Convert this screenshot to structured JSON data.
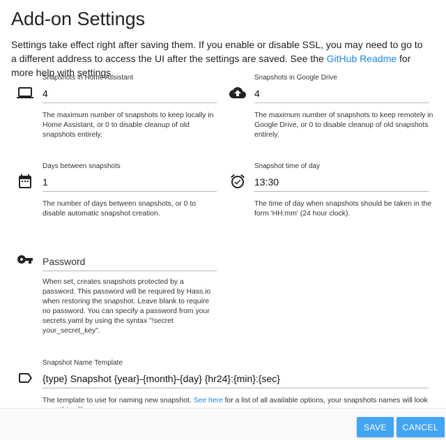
{
  "page": {
    "title": "Add-on Settings",
    "intro_text": "Settings take effect right after saving them. If you enable or disable SSL, you may need to go to a different address to access the UI after the settings are saved. See the ",
    "intro_link": "GitHub Readme",
    "intro_tail": " for more help with settings."
  },
  "fields": {
    "snapshots_ha": {
      "icon": "laptop-icon",
      "label": "Snapshots in Home Assistant",
      "value": "4",
      "help": "The maximum number of snapshots to keep locally in Home Assistant, or 0 to disable cleanup of old snapshots entirely."
    },
    "snapshots_drive": {
      "icon": "cloud-upload-icon",
      "label": "Snapshots in Google Drive",
      "value": "4",
      "help": "The maximum number of snapshots to keep remotely in Google Drive, or 0 to disable cleanup of old snapshots entirely."
    },
    "days_between": {
      "icon": "calendar-icon",
      "label": "Days between snapshots",
      "value": "1",
      "help": "The number of days between snapshots, or 0 to disable automatic snapshot creation."
    },
    "time_of_day": {
      "icon": "alarm-clock-icon",
      "label": "Snapshot time of day",
      "value": "13:30",
      "help": "The time of day when snapshots should be taken in the form 'HH:mm' (24 hour clock)."
    },
    "password": {
      "icon": "key-icon",
      "placeholder": "Password",
      "value": "",
      "help": "When set, creates snapshots protected by a password. This password will be required by Hass.io when restoring the snapshot. Leave blank to require no password. You can specify a password from your secrets.yaml by using the syntax \"!secret your_secret_key\"."
    },
    "name_template": {
      "icon": "label-tag-icon",
      "label": "Snapshot Name Template",
      "value": "{type} Snapshot {year}-{month}-{day} {hr24}:{min}:{sec}",
      "help_before": "The template to use for naming new snapshot. ",
      "help_link": "See here",
      "help_after": " for a list of all available options, your snapshots names will look something like"
    }
  },
  "footer": {
    "save_label": "SAVE",
    "cancel_label": "CANCEL"
  },
  "colors": {
    "accent": "#1e88e5",
    "button": "#42a5f5",
    "icon": "#222222"
  }
}
